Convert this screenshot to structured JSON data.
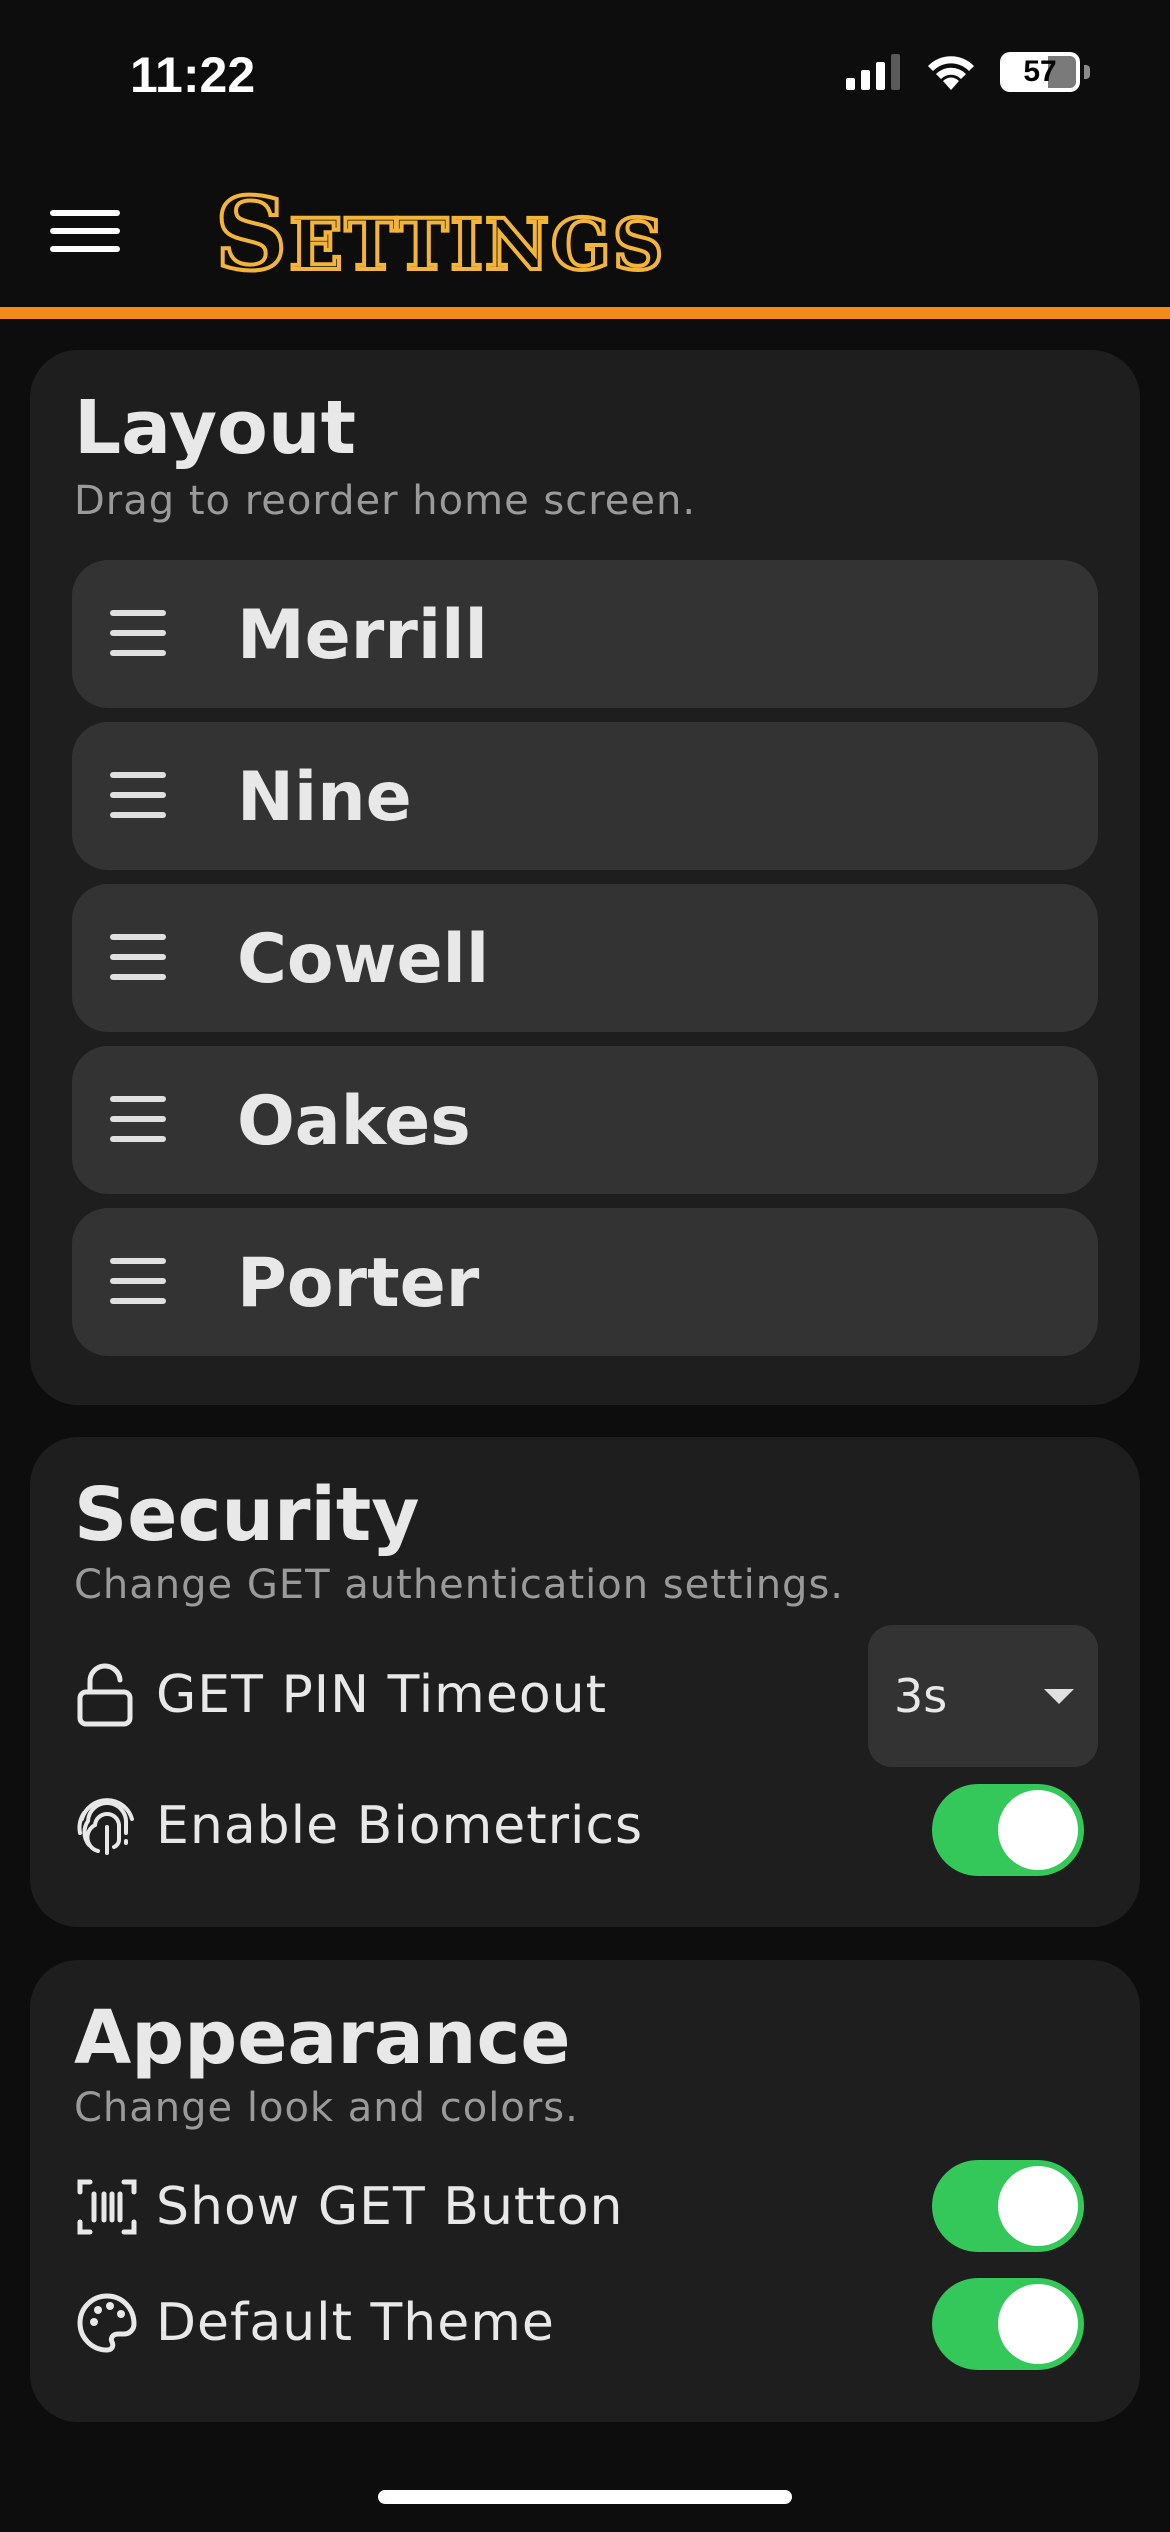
{
  "status_bar": {
    "time": "11:22",
    "battery": "57"
  },
  "header": {
    "title": "Settings",
    "accent_color": "#f28b1a",
    "title_color": "#f3b43a"
  },
  "layout": {
    "title": "Layout",
    "subtitle": "Drag to reorder home screen.",
    "items": [
      {
        "label": "Merrill"
      },
      {
        "label": "Nine"
      },
      {
        "label": "Cowell"
      },
      {
        "label": "Oakes"
      },
      {
        "label": "Porter"
      }
    ]
  },
  "security": {
    "title": "Security",
    "subtitle": "Change GET authentication settings.",
    "pin_timeout": {
      "label": "GET PIN Timeout",
      "value": "3s",
      "icon": "unlock-icon"
    },
    "biometrics": {
      "label": "Enable Biometrics",
      "enabled": true,
      "icon": "fingerprint-icon"
    }
  },
  "appearance": {
    "title": "Appearance",
    "subtitle": "Change look and colors.",
    "show_get_button": {
      "label": "Show GET Button",
      "enabled": true,
      "icon": "barcode-scan-icon"
    },
    "default_theme": {
      "label": "Default Theme",
      "enabled": true,
      "icon": "palette-icon"
    }
  },
  "toggle_on_color": "#34c759"
}
